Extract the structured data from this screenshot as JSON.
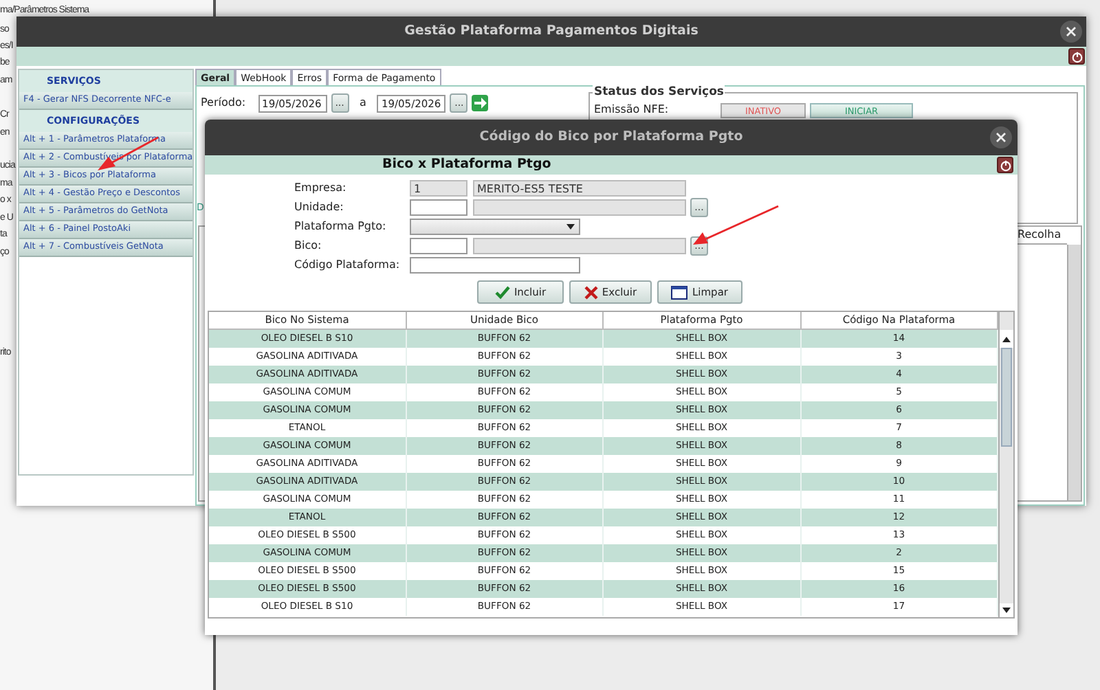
{
  "background_window": {
    "fragments": [
      "ma/Parâmetros Sistema",
      "so",
      "es/I",
      "be",
      "am",
      "Cr",
      "en",
      "ucia",
      "ma",
      "o x",
      "e U",
      "ta",
      "ço",
      "rito"
    ]
  },
  "main_window": {
    "title": "Gestão Plataforma Pagamentos Digitais",
    "sidebar": [
      {
        "heading": "SERVIÇOS",
        "items": [
          "F4 - Gerar NFS Decorrente NFC-e"
        ]
      },
      {
        "heading": "CONFIGURAÇÕES",
        "items": [
          "Alt + 1 - Parâmetros Plataforma",
          "Alt + 2 - Combustíveis por Plataforma",
          "Alt + 3 - Bicos por Plataforma",
          "Alt + 4 - Gestão Preço e Descontos",
          "Alt + 5 - Parâmetros do GetNota",
          "Alt + 6 - Painel PostoAki",
          "Alt + 7 - Combustíveis GetNota"
        ]
      }
    ],
    "tabs": [
      {
        "label": "Geral",
        "selected": true
      },
      {
        "label": "WebHook",
        "selected": false
      },
      {
        "label": "Erros",
        "selected": false
      },
      {
        "label": "Forma de Pagamento",
        "selected": false
      }
    ],
    "period": {
      "label": "Período:",
      "from": "19/05/2026",
      "picker": "...",
      "separator": "a",
      "to": "19/05/2026",
      "picker_2": "..."
    },
    "status": {
      "title": "Status dos Serviços",
      "label": "Emissão NFE:",
      "state": "INATIVO",
      "action": "INICIAR"
    },
    "cut_text": "D",
    "table": {
      "column_last": "Recolha"
    }
  },
  "dialog": {
    "title": "Código do Bico por Plataforma Pgto",
    "header": "Bico x Plataforma Ptgo",
    "fields": [
      {
        "kind": "readonly_pair",
        "label": "Empresa:",
        "code": "1",
        "value": "MERITO-ES5 TESTE"
      },
      {
        "kind": "lookup",
        "label": "Unidade:",
        "button": "..."
      },
      {
        "kind": "select",
        "label": "Plataforma Pgto:"
      },
      {
        "kind": "lookup",
        "label": "Bico:",
        "button": "..."
      },
      {
        "kind": "text",
        "label": "Código Plataforma:"
      }
    ],
    "buttons": [
      "Incluir",
      "Excluir",
      "Limpar"
    ],
    "table": {
      "columns": [
        "Bico No Sistema",
        "Unidade Bico",
        "Plataforma Pgto",
        "Código Na Plataforma"
      ],
      "rows": [
        [
          "OLEO DIESEL B S10",
          "BUFFON 62",
          "SHELL BOX",
          "14"
        ],
        [
          "GASOLINA ADITIVADA",
          "BUFFON 62",
          "SHELL BOX",
          "3"
        ],
        [
          "GASOLINA ADITIVADA",
          "BUFFON 62",
          "SHELL BOX",
          "4"
        ],
        [
          "GASOLINA COMUM",
          "BUFFON 62",
          "SHELL BOX",
          "5"
        ],
        [
          "GASOLINA COMUM",
          "BUFFON 62",
          "SHELL BOX",
          "6"
        ],
        [
          "ETANOL",
          "BUFFON 62",
          "SHELL BOX",
          "7"
        ],
        [
          "GASOLINA COMUM",
          "BUFFON 62",
          "SHELL BOX",
          "8"
        ],
        [
          "GASOLINA ADITIVADA",
          "BUFFON 62",
          "SHELL BOX",
          "9"
        ],
        [
          "GASOLINA ADITIVADA",
          "BUFFON 62",
          "SHELL BOX",
          "10"
        ],
        [
          "GASOLINA COMUM",
          "BUFFON 62",
          "SHELL BOX",
          "11"
        ],
        [
          "ETANOL",
          "BUFFON 62",
          "SHELL BOX",
          "12"
        ],
        [
          "OLEO DIESEL B S500",
          "BUFFON 62",
          "SHELL BOX",
          "13"
        ],
        [
          "GASOLINA COMUM",
          "BUFFON 62",
          "SHELL BOX",
          "2"
        ],
        [
          "OLEO DIESEL B S500",
          "BUFFON 62",
          "SHELL BOX",
          "15"
        ],
        [
          "OLEO DIESEL B S500",
          "BUFFON 62",
          "SHELL BOX",
          "16"
        ],
        [
          "OLEO DIESEL B S10",
          "BUFFON 62",
          "SHELL BOX",
          "17"
        ]
      ]
    }
  }
}
